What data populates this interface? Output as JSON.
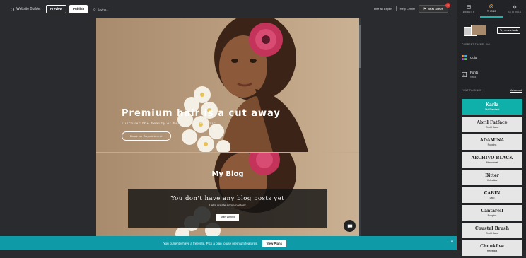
{
  "topbar": {
    "logo_label": "Website Builder",
    "preview_label": "Preview",
    "publish_label": "Publish",
    "saving_label": "Saving...",
    "hire_expert_label": "Hire an Expert",
    "help_center_label": "Help Center",
    "next_steps_label": "Next Steps",
    "next_steps_badge": "3"
  },
  "hero": {
    "title": "Premium hair is a cut away",
    "subtitle": "Discover the beauty of healthy, styled hair",
    "button_label": "Book an Appointment"
  },
  "blog": {
    "title": "My Blog",
    "empty_title": "You don't have any blog posts yet",
    "empty_sub": "Let's create some content",
    "button_label": "Start Writing"
  },
  "banner": {
    "text": "You currently have a free site. Pick a plan to use premium features.",
    "button_label": "View Plans"
  },
  "panel": {
    "tabs": [
      {
        "label": "WEBSITE",
        "icon": "website-icon"
      },
      {
        "label": "THEME",
        "icon": "theme-icon",
        "active": true
      },
      {
        "label": "SETTINGS",
        "icon": "gear-icon"
      }
    ],
    "try_look_label": "Try a new look",
    "current_theme_label": "CURRENT THEME: BIO",
    "color_label": "Color",
    "fonts_label": "Fonts",
    "fonts_value": "Karla",
    "font_pairings_label": "FONT PAIRINGS",
    "advanced_label": "Advanced",
    "font_pairs": [
      {
        "name": "Karla",
        "sub": "Old Standard",
        "selected": true
      },
      {
        "name": "Abril Fatface",
        "sub": "Droid Sans"
      },
      {
        "name": "ADAMINA",
        "sub": "Poppins"
      },
      {
        "name": "ARCHIVO BLACK",
        "sub": "Montserrat"
      },
      {
        "name": "Bitter",
        "sub": "Helvetica"
      },
      {
        "name": "CABIN",
        "sub": "Lato"
      },
      {
        "name": "Cantarell",
        "sub": "Poppins"
      },
      {
        "name": "Coustal Brush",
        "sub": "Droid Sans"
      },
      {
        "name": "Chunkfive",
        "sub": "Helvetica"
      }
    ]
  },
  "colors": {
    "accent": "#0fb0aa",
    "banner": "#0e9aa7",
    "dark": "#2a2b2f"
  }
}
